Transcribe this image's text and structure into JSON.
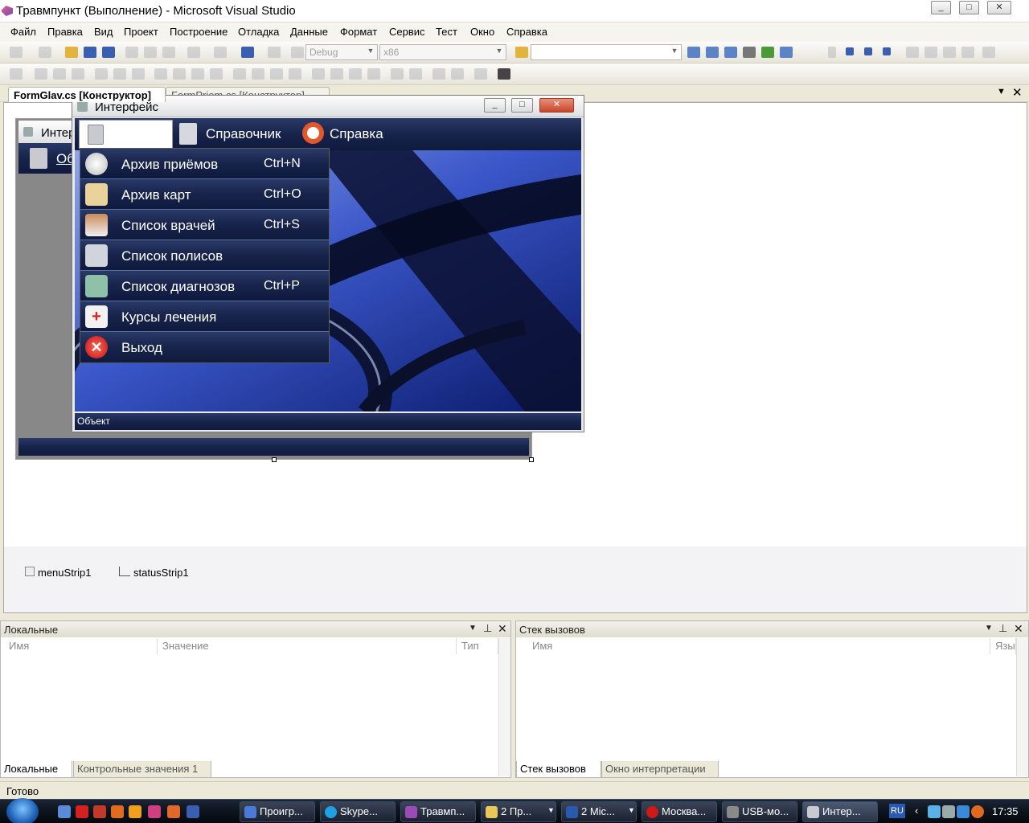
{
  "window": {
    "title": "Травмпункт (Выполнение) - Microsoft Visual Studio",
    "min": "_",
    "max": "□",
    "close": "✕"
  },
  "menu": [
    "Файл",
    "Правка",
    "Вид",
    "Проект",
    "Построение",
    "Отладка",
    "Данные",
    "Формат",
    "Сервис",
    "Тест",
    "Окно",
    "Справка"
  ],
  "toolbar": {
    "config": "Debug",
    "platform": "x86"
  },
  "doc_tabs": {
    "active": "FormGlav.cs [Конструктор]",
    "inactive": "FormPriem.cs [Конструктор]"
  },
  "bg_form": {
    "title": "Интерфейс",
    "menu_item": "Об"
  },
  "form": {
    "title": "Интерфейс",
    "menu": {
      "item2": "Справочник",
      "item3": "Справка"
    },
    "status_text": "Объект",
    "dropdown": [
      {
        "label": "Архив приёмов",
        "shortcut": "Ctrl+N",
        "icon": "clock-icon"
      },
      {
        "label": "Архив карт",
        "shortcut": "Ctrl+O",
        "icon": "card-icon"
      },
      {
        "label": "Список врачей",
        "shortcut": "Ctrl+S",
        "icon": "doctor-icon"
      },
      {
        "label": "Список полисов",
        "shortcut": "",
        "icon": "policy-icon"
      },
      {
        "label": "Список диагнозов",
        "shortcut": "Ctrl+P",
        "icon": "diagnosis-icon"
      },
      {
        "label": "Курсы лечения",
        "shortcut": "",
        "icon": "firstaid-icon"
      },
      {
        "label": "Выход",
        "shortcut": "",
        "icon": "exit-icon"
      }
    ]
  },
  "tray": {
    "menu_strip": "menuStrip1",
    "status_strip": "statusStrip1"
  },
  "locals": {
    "title": "Локальные",
    "col_name": "Имя",
    "col_value": "Значение",
    "col_type": "Тип",
    "tab1": "Локальные",
    "tab2": "Контрольные значения 1"
  },
  "callstack": {
    "title": "Стек вызовов",
    "col_name": "Имя",
    "col_lang": "Язык",
    "tab1": "Стек вызовов",
    "tab2": "Окно интерпретации"
  },
  "status": "Готово",
  "taskbar": {
    "items": [
      "Проигр...",
      "Skype...",
      "Травмп...",
      "2 Пр...",
      "2 Mic...",
      "Москва...",
      "USB-мо...",
      "Интер..."
    ],
    "lang": "RU",
    "clock": "17:35"
  },
  "colors": {
    "menu_dark": "#17234a",
    "accent_blue": "#1a2f8a",
    "vs_bg": "#ece9d8"
  }
}
